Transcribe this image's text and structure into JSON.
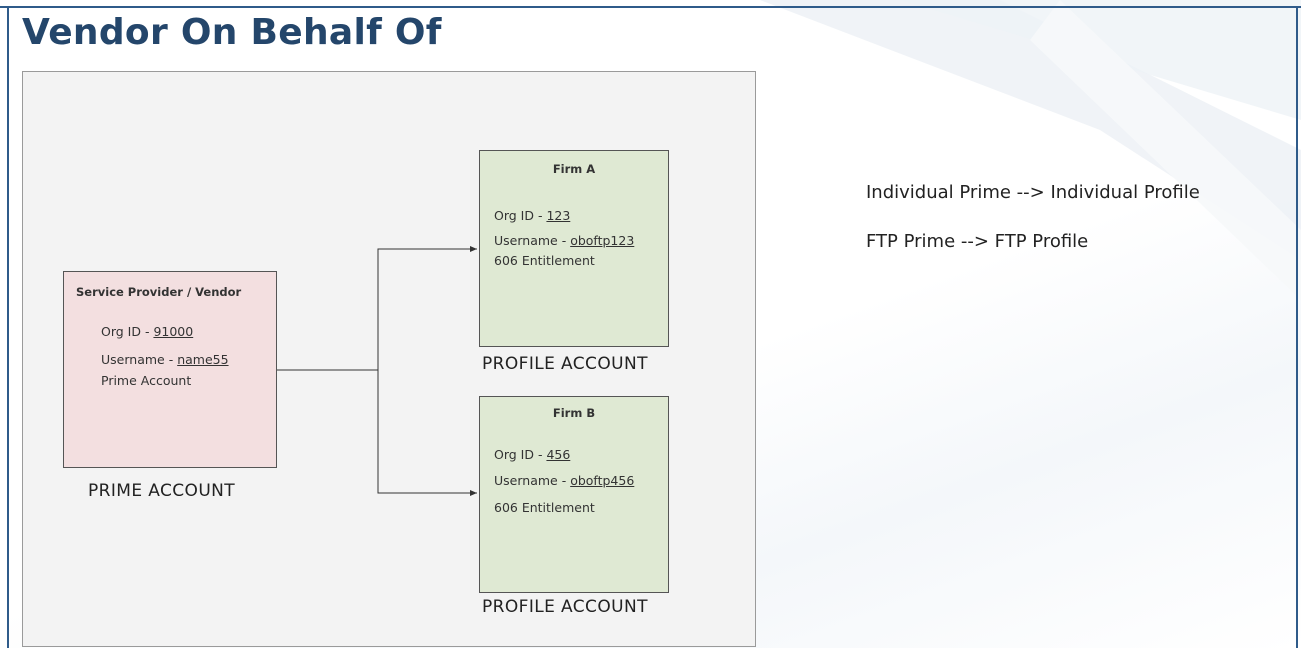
{
  "slide": {
    "title": "Vendor On Behalf Of"
  },
  "diagram": {
    "prime": {
      "title": "Service Provider / Vendor",
      "org_label": "Org ID - ",
      "org_id": "91000",
      "username_label": "Username - ",
      "username": "name55",
      "account_type": "Prime Account",
      "caption": "PRIME ACCOUNT"
    },
    "firm_a": {
      "title": "Firm A",
      "org_label": "Org ID - ",
      "org_id": "123",
      "username_label": "Username - ",
      "username": "oboftp123",
      "entitlement": "606 Entitlement",
      "caption": "PROFILE ACCOUNT"
    },
    "firm_b": {
      "title": "Firm B",
      "org_label": "Org ID - ",
      "org_id": "456",
      "username_label": "Username - ",
      "username": "oboftp456",
      "entitlement": "606 Entitlement",
      "caption": "PROFILE ACCOUNT"
    }
  },
  "notes": [
    "Individual Prime --> Individual Profile",
    "FTP Prime --> FTP Profile"
  ],
  "colors": {
    "title": "#24466b",
    "prime_fill": "#f3dfe0",
    "profile_fill": "#dfe9d3",
    "canvas_fill": "#f3f3f3",
    "frame": "#2f5b8a"
  }
}
